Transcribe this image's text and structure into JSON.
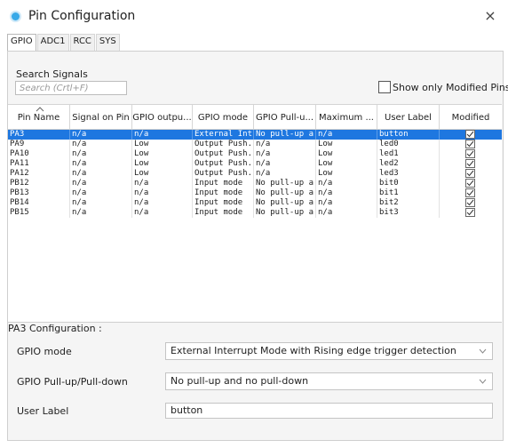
{
  "window": {
    "title": "Pin Configuration",
    "close_glyph": "×",
    "icon": "gear-chip-icon"
  },
  "tabs": [
    "GPIO",
    "ADC1",
    "RCC",
    "SYS"
  ],
  "search": {
    "label": "Search Signals",
    "placeholder": "Search (Crtl+F)",
    "value": ""
  },
  "show_modified": {
    "label": "Show only Modified Pins",
    "checked": false
  },
  "table": {
    "columns": [
      "Pin Name",
      "Signal on Pin",
      "GPIO outpu...",
      "GPIO mode",
      "GPIO Pull-u...",
      "Maximum ...",
      "User Label",
      "Modified"
    ],
    "sorted_column": "Pin Name",
    "selected_row": 0,
    "rows": [
      {
        "pin": "PA3",
        "signal": "n/a",
        "output": "n/a",
        "mode": "External Int...",
        "pull": "No pull-up a...",
        "max": "n/a",
        "label": "button",
        "modified": true
      },
      {
        "pin": "PA9",
        "signal": "n/a",
        "output": "Low",
        "mode": "Output Push...",
        "pull": "n/a",
        "max": "Low",
        "label": "led0",
        "modified": true
      },
      {
        "pin": "PA10",
        "signal": "n/a",
        "output": "Low",
        "mode": "Output Push...",
        "pull": "n/a",
        "max": "Low",
        "label": "led1",
        "modified": true
      },
      {
        "pin": "PA11",
        "signal": "n/a",
        "output": "Low",
        "mode": "Output Push...",
        "pull": "n/a",
        "max": "Low",
        "label": "led2",
        "modified": true
      },
      {
        "pin": "PA12",
        "signal": "n/a",
        "output": "Low",
        "mode": "Output Push...",
        "pull": "n/a",
        "max": "Low",
        "label": "led3",
        "modified": true
      },
      {
        "pin": "PB12",
        "signal": "n/a",
        "output": "n/a",
        "mode": "Input mode",
        "pull": "No pull-up a...",
        "max": "n/a",
        "label": "bit0",
        "modified": true
      },
      {
        "pin": "PB13",
        "signal": "n/a",
        "output": "n/a",
        "mode": "Input mode",
        "pull": "No pull-up a...",
        "max": "n/a",
        "label": "bit1",
        "modified": true
      },
      {
        "pin": "PB14",
        "signal": "n/a",
        "output": "n/a",
        "mode": "Input mode",
        "pull": "No pull-up a...",
        "max": "n/a",
        "label": "bit2",
        "modified": true
      },
      {
        "pin": "PB15",
        "signal": "n/a",
        "output": "n/a",
        "mode": "Input mode",
        "pull": "No pull-up a...",
        "max": "n/a",
        "label": "bit3",
        "modified": true
      }
    ]
  },
  "config": {
    "title": "PA3 Configuration :",
    "gpio_mode": {
      "label": "GPIO mode",
      "value": "External Interrupt Mode with Rising edge trigger detection"
    },
    "pull": {
      "label": "GPIO Pull-up/Pull-down",
      "value": "No pull-up and no pull-down"
    },
    "user_label": {
      "label": "User Label",
      "value": "button"
    }
  },
  "colors": {
    "selection": "#1e77e0",
    "accent": "#38a9e8"
  }
}
